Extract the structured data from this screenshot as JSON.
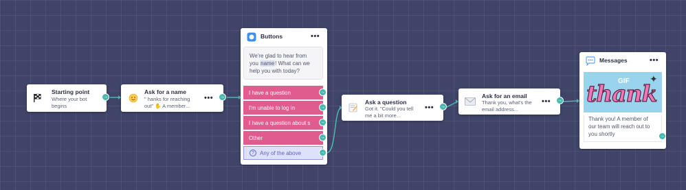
{
  "nodes": {
    "start": {
      "title": "Starting point",
      "subtitle": "Where your bot begins",
      "icon": "checkered-flag-icon"
    },
    "ask_name": {
      "title": "Ask for a name",
      "subtitle": "\" hanks for reaching out\" ✋ A member...",
      "icon": "smiling-face-icon"
    },
    "buttons": {
      "title": "Buttons",
      "icon": "chat-bubble-icon",
      "message_before": "We're glad to hear from you ",
      "variable": "name",
      "message_after": "! What can we help you with today?",
      "options": [
        {
          "label": "I have a question"
        },
        {
          "label": "I'm unable to log in"
        },
        {
          "label": "I have a question about s"
        },
        {
          "label": "Other"
        }
      ],
      "fallback": {
        "label": "Any of the above",
        "icon": "question-circle-icon"
      }
    },
    "ask_question": {
      "title": "Ask a question",
      "subtitle": "Got it. \"Could you tell me a bit more...",
      "icon": "memo-icon"
    },
    "ask_email": {
      "title": "Ask for an email",
      "subtitle": "Thank you, what's the email address...",
      "icon": "envelope-icon"
    },
    "messages": {
      "title": "Messages",
      "icon": "speech-bubble-icon",
      "gif_badge": "GIF",
      "gif_text": "thank",
      "text": "Thank you! A member of our team will reach out to you shortly"
    }
  },
  "menu_glyph": "•••",
  "port_glyph": "→",
  "colors": {
    "canvas": "#3f4468",
    "connector": "#4fb8b0",
    "button_fill": "#e05c8f",
    "fallback_fill": "#dde1fb",
    "buttons_header_icon": "#3f8fe8",
    "gif_background": "#9ad4ec",
    "gif_text": "#f277b8"
  }
}
